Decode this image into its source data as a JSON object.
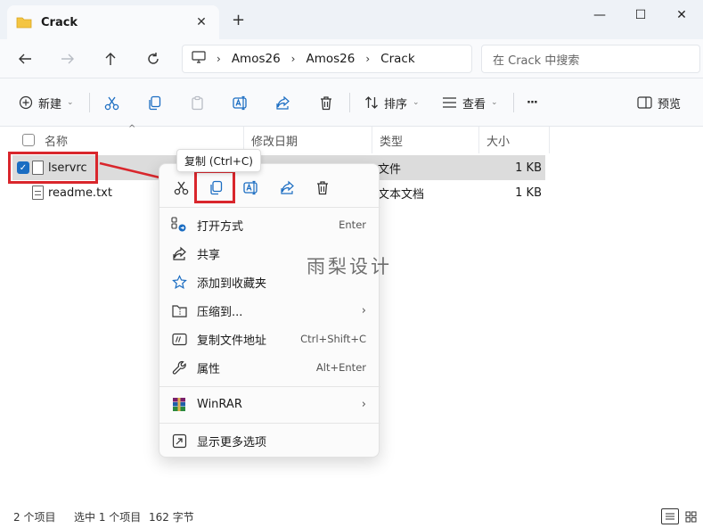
{
  "window": {
    "tab_title": "Crack",
    "tab_close": "✕",
    "new_tab": "+",
    "controls": {
      "minimize": "—",
      "maximize": "☐",
      "close": "✕"
    }
  },
  "address": {
    "breadcrumbs": [
      "Amos26",
      "Amos26",
      "Crack"
    ],
    "separator": "›",
    "search_placeholder": "在 Crack 中搜索"
  },
  "toolbar": {
    "new_label": "新建",
    "sort_label": "排序",
    "view_label": "查看",
    "more_label": "···",
    "preview_label": "预览"
  },
  "columns": {
    "name": "名称",
    "modified": "修改日期",
    "type": "类型",
    "size": "大小"
  },
  "files": [
    {
      "name": "lservrc",
      "type": "文件",
      "size": "1 KB",
      "selected": true
    },
    {
      "name": "readme.txt",
      "type": "文本文档",
      "size": "1 KB",
      "selected": false
    }
  ],
  "tooltip": "复制 (Ctrl+C)",
  "context_menu": {
    "items": [
      {
        "label": "打开方式",
        "shortcut": "Enter"
      },
      {
        "label": "共享",
        "shortcut": ""
      },
      {
        "label": "添加到收藏夹",
        "shortcut": ""
      },
      {
        "label": "压缩到...",
        "shortcut": "›"
      },
      {
        "label": "复制文件地址",
        "shortcut": "Ctrl+Shift+C"
      },
      {
        "label": "属性",
        "shortcut": "Alt+Enter"
      },
      {
        "label": "WinRAR",
        "shortcut": "›"
      },
      {
        "label": "显示更多选项",
        "shortcut": ""
      }
    ]
  },
  "watermark": "雨梨设计",
  "status": {
    "item_count": "2 个项目",
    "selection": "选中 1 个项目",
    "selection_size": "162 字节"
  },
  "colors": {
    "accent": "#1b6dc2",
    "annotation_red": "#d9262c",
    "folder_yellow": "#f4c542"
  }
}
